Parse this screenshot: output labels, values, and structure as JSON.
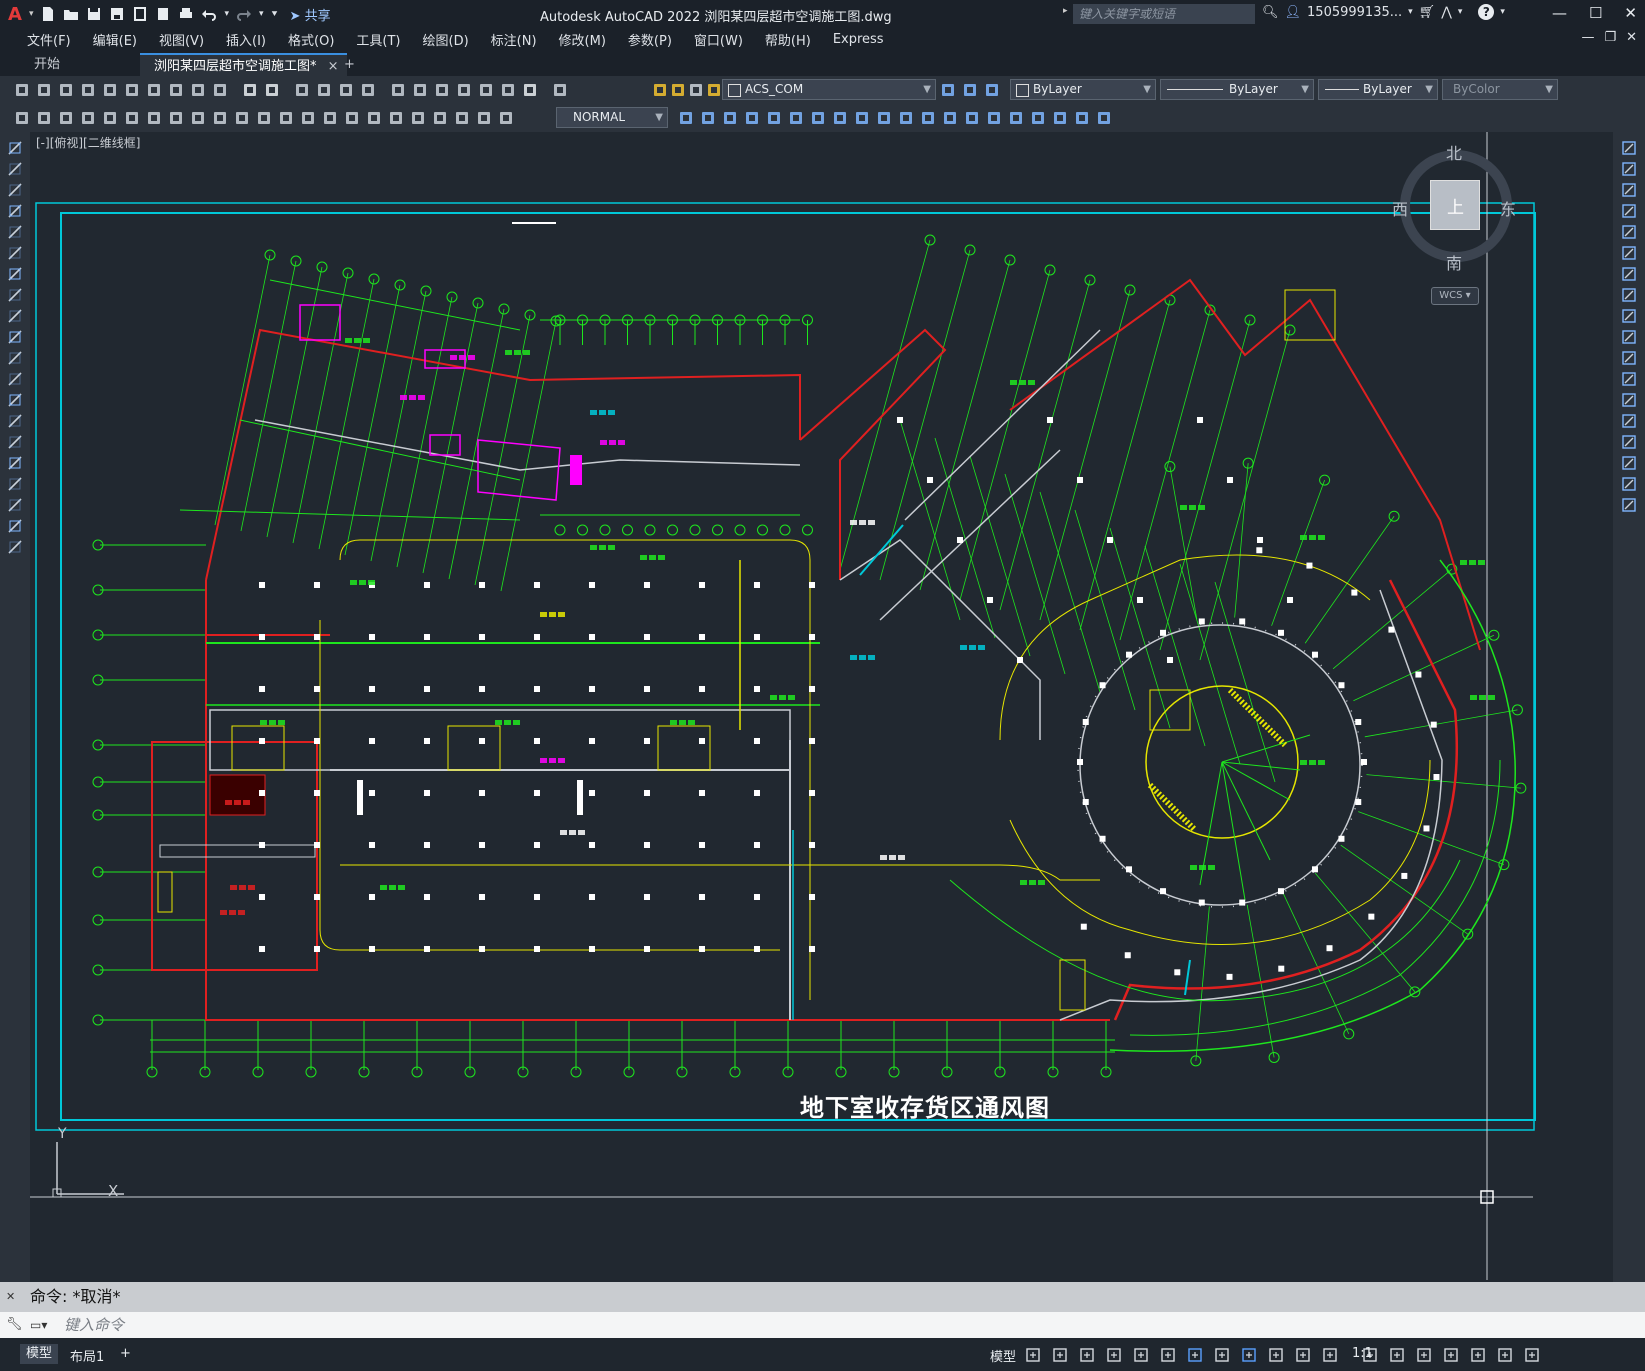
{
  "app": {
    "logo": "A",
    "title": "Autodesk AutoCAD 2022    浏阳某四层超市空调施工图.dwg",
    "share_label": "共享",
    "search_placeholder": "键入关键字或短语",
    "user": "1505999135...",
    "help": "?"
  },
  "menu": [
    "文件(F)",
    "编辑(E)",
    "视图(V)",
    "插入(I)",
    "格式(O)",
    "工具(T)",
    "绘图(D)",
    "标注(N)",
    "修改(M)",
    "参数(P)",
    "窗口(W)",
    "帮助(H)",
    "Express"
  ],
  "tabs": {
    "start": "开始",
    "file": "浏阳某四层超市空调施工图*",
    "close": "×",
    "add": "+"
  },
  "toolbar": {
    "layer": "ACS_COM",
    "color": "ByLayer",
    "linetype": "ByLayer",
    "lineweight": "ByLayer",
    "plotstyle": "ByColor",
    "dimstyle": "NORMAL"
  },
  "viewport": {
    "label": "[-][俯视][二维线框]",
    "compass": {
      "north": "北",
      "south": "南",
      "east": "东",
      "west": "西",
      "top": "上"
    },
    "wcs": "WCS",
    "drawing_title": "地下室收存货区通风图",
    "ucs_y": "Y",
    "ucs_x": "X"
  },
  "command": {
    "history": "命令:  *取消*",
    "placeholder": "键入命令"
  },
  "status": {
    "model_tab": "模型",
    "layout_tab": "布局1",
    "add": "+",
    "model_button": "模型",
    "scale": "1:1"
  },
  "colors": {
    "background": "#212830",
    "frame": "#00c8d8",
    "grid_green": "#1ee61e",
    "wall_red": "#e02020",
    "yellow": "#e6e600",
    "magenta": "#ff00ff",
    "white": "#ffffff"
  }
}
